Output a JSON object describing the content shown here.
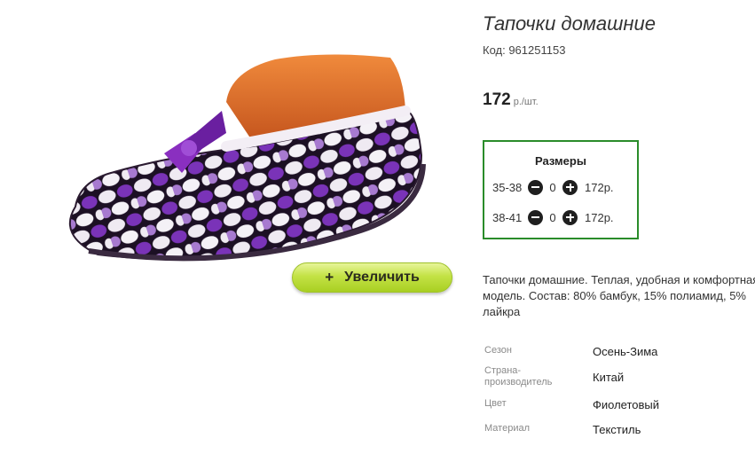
{
  "product": {
    "title": "Тапочки домашние",
    "sku": "Код: 961251153",
    "price": "172",
    "price_unit": "р./шт.",
    "description": "Тапочки домашние. Теплая, удобная и комфортная модель. Состав: 80% бамбук, 15% полиамид, 5% лайкра",
    "image_alt": "slipper-photo"
  },
  "zoom": {
    "plus": "+",
    "label": "Увеличить"
  },
  "sizes": {
    "title": "Размеры",
    "rows": [
      {
        "size": "35-38",
        "qty": "0",
        "price": "172р."
      },
      {
        "size": "38-41",
        "qty": "0",
        "price": "172р."
      }
    ]
  },
  "specs": [
    {
      "label": "Сезон",
      "value": "Осень-Зима"
    },
    {
      "label": "Страна-производитель",
      "value": "Китай"
    },
    {
      "label": "Цвет",
      "value": "Фиолетовый"
    },
    {
      "label": "Материал",
      "value": "Текстиль"
    }
  ],
  "colors": {
    "frame_green": "#2a8c2a",
    "button_green": "#b5d934",
    "slipper_purple": "#7a33b8",
    "last_orange": "#e06a2a"
  }
}
